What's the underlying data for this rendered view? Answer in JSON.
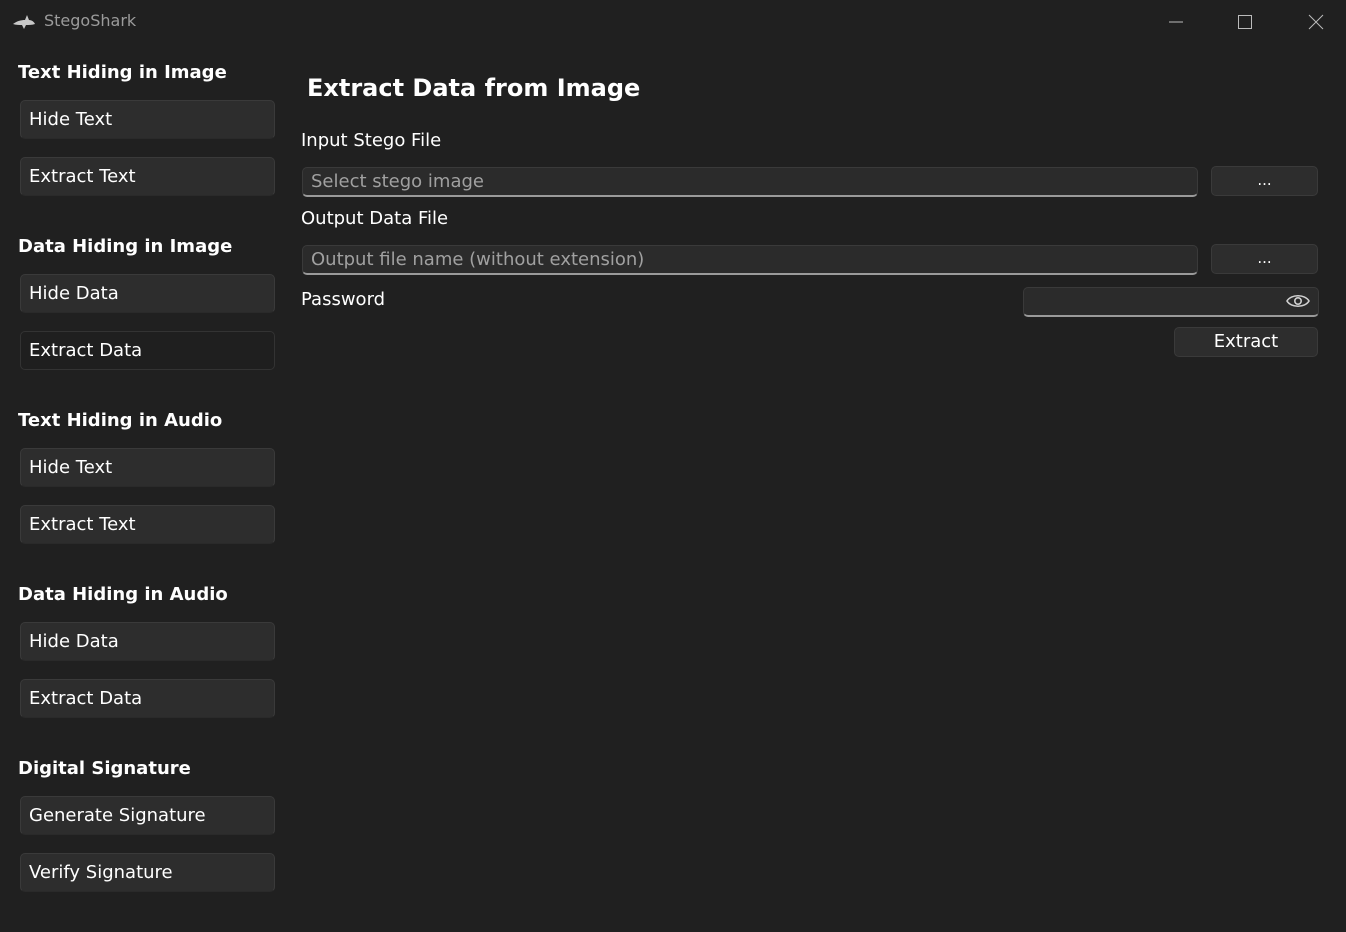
{
  "window": {
    "title": "StegoShark",
    "app_icon": "shark-icon",
    "controls": [
      "minimize-icon",
      "maximize-icon",
      "close-icon"
    ]
  },
  "sidebar": {
    "sections": [
      {
        "title": "Text Hiding in Image",
        "items": [
          "Hide Text",
          "Extract Text"
        ]
      },
      {
        "title": "Data Hiding in Image",
        "items": [
          "Hide Data",
          "Extract Data"
        ]
      },
      {
        "title": "Text Hiding in Audio",
        "items": [
          "Hide Text",
          "Extract Text"
        ]
      },
      {
        "title": "Data Hiding in Audio",
        "items": [
          "Hide Data",
          "Extract Data"
        ]
      },
      {
        "title": "Digital Signature",
        "items": [
          "Generate Signature",
          "Verify Signature"
        ]
      }
    ],
    "selected": "Data Hiding in Image / Extract Data"
  },
  "main": {
    "title": "Extract Data from Image",
    "input_label": "Input Stego File",
    "input_placeholder": "Select stego image",
    "input_browse": "...",
    "output_label": "Output Data File",
    "output_placeholder": "Output file name (without extension)",
    "output_browse": "...",
    "password_label": "Password",
    "password_value": "",
    "password_icon": "eye-icon",
    "extract_label": "Extract"
  },
  "colors": {
    "background": "#202020",
    "button": "#2d2d2d",
    "selected_button": "#1f1f1f",
    "text": "#ffffff",
    "placeholder": "#a0a0a0"
  }
}
